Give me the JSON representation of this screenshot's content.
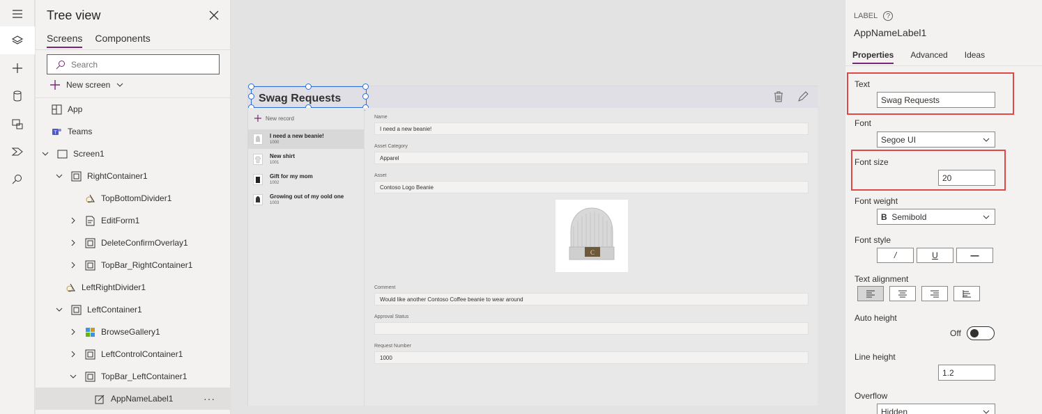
{
  "rail": {
    "icons": [
      "hamburger-icon",
      "layers-icon",
      "plus-icon",
      "database-icon",
      "media-icon",
      "power-automate-icon",
      "search-icon"
    ]
  },
  "tree": {
    "title": "Tree view",
    "tabs": [
      "Screens",
      "Components"
    ],
    "search_placeholder": "Search",
    "new_screen": "New screen",
    "items": [
      {
        "label": "App",
        "level": 0
      },
      {
        "label": "Teams",
        "level": 0
      },
      {
        "label": "Screen1",
        "level": 0
      },
      {
        "label": "RightContainer1",
        "level": 1
      },
      {
        "label": "TopBottomDivider1",
        "level": 2
      },
      {
        "label": "EditForm1",
        "level": 2
      },
      {
        "label": "DeleteConfirmOverlay1",
        "level": 2
      },
      {
        "label": "TopBar_RightContainer1",
        "level": 2
      },
      {
        "label": "LeftRightDivider1",
        "level": 1
      },
      {
        "label": "LeftContainer1",
        "level": 1
      },
      {
        "label": "BrowseGallery1",
        "level": 2
      },
      {
        "label": "LeftControlContainer1",
        "level": 2
      },
      {
        "label": "TopBar_LeftContainer1",
        "level": 2
      },
      {
        "label": "AppNameLabel1",
        "level": 3
      }
    ],
    "more": "···"
  },
  "app": {
    "title": "Swag Requests",
    "new_record": "New record",
    "gallery": [
      {
        "title": "I need a new beanie!",
        "sub": "1000"
      },
      {
        "title": "New shirt",
        "sub": "1001"
      },
      {
        "title": "Gift for my mom",
        "sub": "1002"
      },
      {
        "title": "Growing out of my oold one",
        "sub": "1003"
      }
    ],
    "form": {
      "name_label": "Name",
      "name_value": "I need a new beanie!",
      "category_label": "Asset Category",
      "category_value": "Apparel",
      "asset_label": "Asset",
      "asset_value": "Contoso Logo Beanie",
      "comment_label": "Comment",
      "comment_value": "Would like another Contoso Coffee beanie to wear around",
      "approval_label": "Approval Status",
      "approval_value": "",
      "request_label": "Request Number",
      "request_value": "1000"
    }
  },
  "props": {
    "kind": "LABEL",
    "help": "?",
    "name": "AppNameLabel1",
    "tabs": [
      "Properties",
      "Advanced",
      "Ideas"
    ],
    "text_label": "Text",
    "text_value": "Swag Requests",
    "font_label": "Font",
    "font_value": "Segoe UI",
    "font_size_label": "Font size",
    "font_size_value": "20",
    "font_weight_label": "Font weight",
    "font_weight_value": "Semibold",
    "font_weight_glyph": "B",
    "font_style_label": "Font style",
    "font_style_buttons": [
      "/",
      "U",
      "—"
    ],
    "text_alignment_label": "Text alignment",
    "auto_height_label": "Auto height",
    "auto_height_value": "Off",
    "line_height_label": "Line height",
    "line_height_value": "1.2",
    "overflow_label": "Overflow",
    "overflow_value": "Hidden"
  },
  "colors": {
    "accent": "#742774",
    "highlight": "#e04848",
    "selection": "#2b6cd6"
  }
}
